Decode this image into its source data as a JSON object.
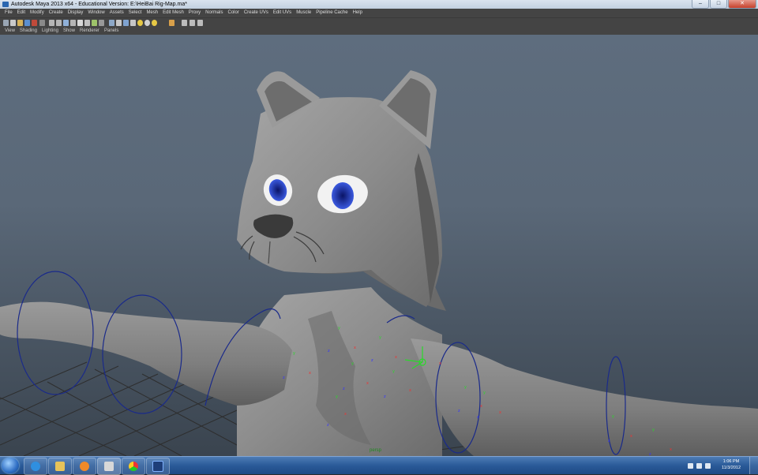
{
  "window": {
    "title": "Autodesk Maya 2013 x64 - Educational Version: E:\\HeiBai Rig-Map.ma*",
    "minimize_label": "–",
    "maximize_label": "□",
    "close_label": "✕"
  },
  "menu": {
    "items": [
      "File",
      "Edit",
      "Modify",
      "Create",
      "Display",
      "Window",
      "Assets",
      "Select",
      "Mesh",
      "Edit Mesh",
      "Proxy",
      "Normals",
      "Color",
      "Create UVs",
      "Edit UVs",
      "Muscle",
      "Pipeline Cache",
      "Help"
    ]
  },
  "panel_menu": {
    "items": [
      "View",
      "Shading",
      "Lighting",
      "Show",
      "Renderer",
      "Panels"
    ]
  },
  "viewport": {
    "camera_label": "persp"
  },
  "taskbar": {
    "apps": [
      "internet-explorer-icon",
      "file-explorer-icon",
      "media-player-icon",
      "maya-icon",
      "chrome-icon",
      "photoshop-icon"
    ],
    "time": "1:06 PM",
    "date": "11/3/2012"
  },
  "colors": {
    "viewport_top": "#5e6d7e",
    "viewport_bottom": "#3a444f",
    "menu_bg": "#444444",
    "taskbar": "#2a5a98",
    "eye_blue": "#1a2e9e",
    "rig_curve": "#1a2a8a"
  }
}
